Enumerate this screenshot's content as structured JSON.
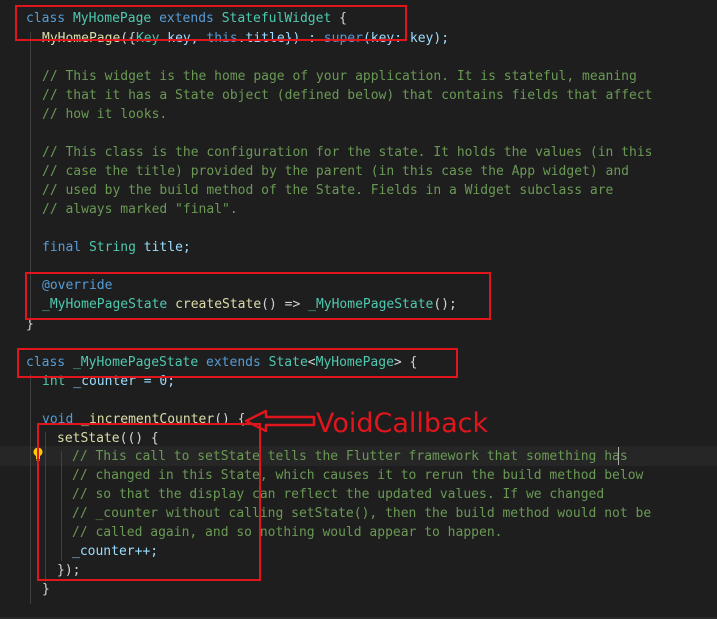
{
  "code": {
    "l1": {
      "kw1": "class",
      "name": "MyHomePage",
      "kw2": "extends",
      "sup": "StatefulWidget",
      "rest": " {"
    },
    "l2": {
      "ctor": "MyHomePage",
      "p1": "({",
      "ty": "Key",
      "p2": " key, ",
      "this": "this",
      "p3": ".title}) : ",
      "super": "super",
      "p4": "(key: key);"
    },
    "l3": "// This widget is the home page of your application. It is stateful, meaning",
    "l4": "// that it has a State object (defined below) that contains fields that affect",
    "l5": "// how it looks.",
    "l6": "// This class is the configuration for the state. It holds the values (in this",
    "l7": "// case the title) provided by the parent (in this case the App widget) and",
    "l8": "// used by the build method of the State. Fields in a Widget subclass are",
    "l9": "// always marked \"final\".",
    "l10": {
      "kw": "final",
      "ty": "String",
      "rest": " title;"
    },
    "l11": "@override",
    "l12": {
      "ty": "_MyHomePageState",
      "fn": "createState",
      "mid": "() => ",
      "ty2": "_MyHomePageState",
      "end": "();"
    },
    "l13": "}",
    "l14": {
      "kw1": "class",
      "name": "_MyHomePageState",
      "kw2": "extends",
      "sup": "State",
      "lt": "<",
      "gen": "MyHomePage",
      "gt": "> {"
    },
    "l15": {
      "ty": "int",
      "rest": " _counter = 0;"
    },
    "l16": {
      "kw": "void",
      "fn": "_incrementCounter",
      "rest": "() {"
    },
    "l17": {
      "fn": "setState",
      "rest": "(() {"
    },
    "l18": "// This call to setState tells the Flutter framework that something has",
    "l19": "// changed in this State, which causes it to rerun the build method below",
    "l20": "// so that the display can reflect the updated values. If we changed",
    "l21": "// _counter without calling setState(), then the build method would not be",
    "l22": "// called again, and so nothing would appear to happen.",
    "l23": "_counter++;",
    "l24": "});",
    "l25": "}"
  },
  "annotation": {
    "label": "VoidCallback"
  },
  "colors": {
    "highlight": "#e0161c",
    "background": "#1e1e1e"
  }
}
